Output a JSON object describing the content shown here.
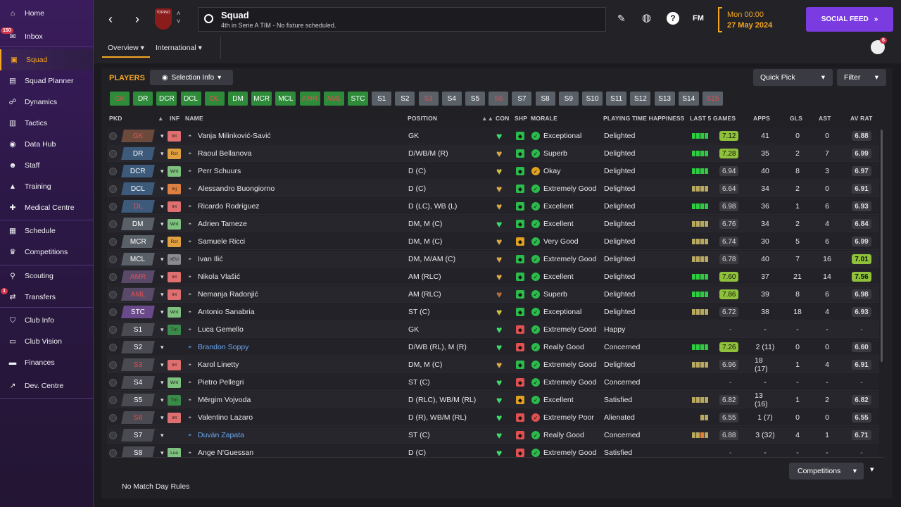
{
  "sidebar": {
    "items": [
      {
        "label": "Home",
        "icon": "home-icon"
      },
      {
        "label": "Inbox",
        "icon": "inbox-icon",
        "badge": "150"
      },
      {
        "label": "Squad",
        "icon": "shirt-icon"
      },
      {
        "label": "Squad Planner",
        "icon": "clipboard-icon"
      },
      {
        "label": "Dynamics",
        "icon": "people-icon"
      },
      {
        "label": "Tactics",
        "icon": "tactics-board-icon"
      },
      {
        "label": "Data Hub",
        "icon": "data-icon"
      },
      {
        "label": "Staff",
        "icon": "staff-icon"
      },
      {
        "label": "Training",
        "icon": "cone-icon"
      },
      {
        "label": "Medical Centre",
        "icon": "medical-kit-icon"
      },
      {
        "label": "Schedule",
        "icon": "calendar-icon"
      },
      {
        "label": "Competitions",
        "icon": "trophy-icon"
      },
      {
        "label": "Scouting",
        "icon": "magnifier-icon"
      },
      {
        "label": "Transfers",
        "icon": "transfer-icon",
        "badge": "1"
      },
      {
        "label": "Club Info",
        "icon": "shield-icon"
      },
      {
        "label": "Club Vision",
        "icon": "briefcase-icon"
      },
      {
        "label": "Finances",
        "icon": "money-icon"
      },
      {
        "label": "Dev. Centre",
        "icon": "dev-centre-icon"
      }
    ]
  },
  "header": {
    "title": "Squad",
    "subtitle": "4th in Serie A TIM - No fixture scheduled.",
    "club_crest": "TORINO",
    "date_time": "Mon 00:00",
    "date": "27 May 2024",
    "social_feed": "SOCIAL FEED",
    "fm_label": "FM",
    "notif_badge": "6"
  },
  "tabs": [
    {
      "label": "Overview"
    },
    {
      "label": "International"
    }
  ],
  "players_section": {
    "heading": "PLAYERS",
    "selection_info": "Selection Info",
    "quick_pick": "Quick Pick",
    "filter": "Filter"
  },
  "position_filters": [
    {
      "label": "GK",
      "style": "greenr"
    },
    {
      "label": "DR",
      "style": "green"
    },
    {
      "label": "DCR",
      "style": "green"
    },
    {
      "label": "DCL",
      "style": "green"
    },
    {
      "label": "DL",
      "style": "greenr"
    },
    {
      "label": "DM",
      "style": "green"
    },
    {
      "label": "MCR",
      "style": "green"
    },
    {
      "label": "MCL",
      "style": "green"
    },
    {
      "label": "AMR",
      "style": "greenr"
    },
    {
      "label": "AML",
      "style": "greenr"
    },
    {
      "label": "STC",
      "style": "green"
    },
    {
      "label": "S1",
      "style": "grey"
    },
    {
      "label": "S2",
      "style": "grey"
    },
    {
      "label": "S3",
      "style": "greyr"
    },
    {
      "label": "S4",
      "style": "grey"
    },
    {
      "label": "S5",
      "style": "grey"
    },
    {
      "label": "S6",
      "style": "greyr"
    },
    {
      "label": "S7",
      "style": "grey"
    },
    {
      "label": "S8",
      "style": "grey"
    },
    {
      "label": "S9",
      "style": "grey"
    },
    {
      "label": "S10",
      "style": "grey"
    },
    {
      "label": "S11",
      "style": "grey"
    },
    {
      "label": "S12",
      "style": "grey"
    },
    {
      "label": "S13",
      "style": "grey"
    },
    {
      "label": "S14",
      "style": "grey"
    },
    {
      "label": "S15",
      "style": "greyr"
    }
  ],
  "columns": {
    "pkd": "PKD",
    "inf": "INF",
    "name": "NAME",
    "position": "POSITION",
    "con": "CON",
    "shp": "SHP",
    "morale": "MORALE",
    "pth": "PLAYING TIME HAPPINESS",
    "last5": "LAST 5 GAMES",
    "apps": "APPS",
    "gls": "GLS",
    "ast": "AST",
    "avrat": "AV RAT"
  },
  "players": [
    {
      "pkd": "GK",
      "pkd_col": "#6b4a3c",
      "pkd_red": true,
      "inf": "Int",
      "inf_col": "#e07070",
      "name": "Vanja Milinković-Savić",
      "link": false,
      "pos": "GK",
      "con": "#3ddc6a",
      "shp": "#2bbb4a",
      "morale_col": "#2bbb4a",
      "morale": "Exceptional",
      "pth": "Delighted",
      "bars": [
        "g",
        "g",
        "g",
        "g"
      ],
      "l5": "7.12",
      "l5_chip": true,
      "apps": "41",
      "gls": "0",
      "ast": "0",
      "avr": "6.88",
      "avr_chip": false
    },
    {
      "pkd": "DR",
      "pkd_col": "#3d5a7a",
      "inf": "Rst",
      "inf_col": "#e0a040",
      "name": "Raoul Bellanova",
      "pos": "D/WB/M (R)",
      "con": "#d9a84a",
      "shp": "#2bbb4a",
      "morale_col": "#2bbb4a",
      "morale": "Superb",
      "pth": "Delighted",
      "bars": [
        "g",
        "g",
        "g",
        "g"
      ],
      "l5": "7.28",
      "l5_chip": true,
      "apps": "35",
      "gls": "2",
      "ast": "7",
      "avr": "6.99"
    },
    {
      "pkd": "DCR",
      "pkd_col": "#3d5a7a",
      "inf": "Wnt",
      "inf_col": "#7ec07e",
      "name": "Perr Schuurs",
      "pos": "D (C)",
      "con": "#c8c040",
      "shp": "#2bbb4a",
      "morale_col": "#e0a020",
      "morale": "Okay",
      "pth": "Delighted",
      "bars": [
        "g",
        "g",
        "g",
        "g"
      ],
      "l5": "6.94",
      "apps": "40",
      "gls": "8",
      "ast": "3",
      "avr": "6.97"
    },
    {
      "pkd": "DCL",
      "pkd_col": "#3d5a7a",
      "inf": "Inj",
      "inf_col": "#e08040",
      "name": "Alessandro Buongiorno",
      "pos": "D (C)",
      "con": "#d9a84a",
      "shp": "#2bbb4a",
      "morale_col": "#2bbb4a",
      "morale": "Extremely Good",
      "pth": "Delighted",
      "bars": [
        "y",
        "y",
        "y",
        "y"
      ],
      "l5": "6.64",
      "apps": "34",
      "gls": "2",
      "ast": "0",
      "avr": "6.91"
    },
    {
      "pkd": "DL",
      "pkd_col": "#3d5a7a",
      "pkd_red": true,
      "inf": "Int",
      "inf_col": "#e07070",
      "name": "Ricardo Rodríguez",
      "pos": "D (LC), WB (L)",
      "con": "#d9a84a",
      "shp": "#2bbb4a",
      "morale_col": "#2bbb4a",
      "morale": "Excellent",
      "pth": "Delighted",
      "bars": [
        "g",
        "g",
        "g",
        "g"
      ],
      "l5": "6.98",
      "apps": "36",
      "gls": "1",
      "ast": "6",
      "avr": "6.93"
    },
    {
      "pkd": "DM",
      "pkd_col": "#5a6068",
      "inf": "Wnt",
      "inf_col": "#7ec07e",
      "name": "Adrien Tameze",
      "pos": "DM, M (C)",
      "con": "#3ddc6a",
      "shp": "#2bbb4a",
      "morale_col": "#2bbb4a",
      "morale": "Excellent",
      "pth": "Delighted",
      "bars": [
        "y",
        "y",
        "y",
        "y"
      ],
      "l5": "6.76",
      "apps": "34",
      "gls": "2",
      "ast": "4",
      "avr": "6.84"
    },
    {
      "pkd": "MCR",
      "pkd_col": "#5a6068",
      "inf": "Rst",
      "inf_col": "#e0a040",
      "name": "Samuele Ricci",
      "pos": "DM, M (C)",
      "con": "#d9a84a",
      "shp": "#e0a020",
      "morale_col": "#2bbb4a",
      "morale": "Very Good",
      "pth": "Delighted",
      "bars": [
        "y",
        "y",
        "y",
        "y"
      ],
      "l5": "6.74",
      "apps": "30",
      "gls": "5",
      "ast": "6",
      "avr": "6.99"
    },
    {
      "pkd": "MCL",
      "pkd_col": "#5a6068",
      "inf": "nEU",
      "inf_col": "#8a8a90",
      "name": "Ivan Ilić",
      "pos": "DM, M/AM (C)",
      "con": "#d9a84a",
      "shp": "#2bbb4a",
      "morale_col": "#2bbb4a",
      "morale": "Extremely Good",
      "pth": "Delighted",
      "bars": [
        "y",
        "y",
        "y",
        "y"
      ],
      "l5": "6.78",
      "apps": "40",
      "gls": "7",
      "ast": "16",
      "avr": "7.01",
      "avr_chip": true
    },
    {
      "pkd": "AMR",
      "pkd_col": "#5a4a6a",
      "pkd_red": true,
      "inf": "Int",
      "inf_col": "#e07070",
      "name": "Nikola Vlašić",
      "pos": "AM (RLC)",
      "con": "#d9a84a",
      "shp": "#2bbb4a",
      "morale_col": "#2bbb4a",
      "morale": "Excellent",
      "pth": "Delighted",
      "bars": [
        "g",
        "g",
        "g",
        "g"
      ],
      "l5": "7.60",
      "l5_chip": true,
      "apps": "37",
      "gls": "21",
      "ast": "14",
      "avr": "7.56",
      "avr_chip": true
    },
    {
      "pkd": "AML",
      "pkd_col": "#5a4a6a",
      "pkd_red": true,
      "inf": "Int",
      "inf_col": "#e07070",
      "name": "Nemanja Radonjić",
      "pos": "AM (RLC)",
      "con": "#b0703a",
      "shp": "#2bbb4a",
      "morale_col": "#2bbb4a",
      "morale": "Superb",
      "pth": "Delighted",
      "bars": [
        "g",
        "g",
        "g",
        "g"
      ],
      "l5": "7.86",
      "l5_chip": true,
      "apps": "39",
      "gls": "8",
      "ast": "6",
      "avr": "6.98"
    },
    {
      "pkd": "STC",
      "pkd_col": "#6a4a8a",
      "inf": "Wnt",
      "inf_col": "#7ec07e",
      "name": "Antonio Sanabria",
      "pos": "ST (C)",
      "con": "#c8c040",
      "shp": "#2bbb4a",
      "morale_col": "#2bbb4a",
      "morale": "Exceptional",
      "pth": "Delighted",
      "bars": [
        "y",
        "y",
        "y",
        "y"
      ],
      "l5": "6.72",
      "apps": "38",
      "gls": "18",
      "ast": "4",
      "avr": "6.93"
    },
    {
      "pkd": "S1",
      "pkd_col": "#4a4a52",
      "inf": "Trn",
      "inf_col": "#3a8a4a",
      "name": "Luca Gemello",
      "pos": "GK",
      "con": "#3ddc6a",
      "shp": "#e05050",
      "morale_col": "#2bbb4a",
      "morale": "Extremely Good",
      "pth": "Happy",
      "bars": [],
      "l5": "-",
      "apps": "-",
      "gls": "-",
      "ast": "-",
      "avr": "-"
    },
    {
      "pkd": "S2",
      "pkd_col": "#4a4a52",
      "inf": "",
      "inf_col": "",
      "name": "Brandon Soppy",
      "link": true,
      "pos": "D/WB (RL), M (R)",
      "con": "#3ddc6a",
      "shp": "#e05050",
      "morale_col": "#2bbb4a",
      "morale": "Really Good",
      "pth": "Concerned",
      "bars": [
        "g",
        "g",
        "g",
        "g"
      ],
      "l5": "7.26",
      "l5_chip": true,
      "apps": "2 (11)",
      "gls": "0",
      "ast": "0",
      "avr": "6.60"
    },
    {
      "pkd": "S3",
      "pkd_col": "#4a4a52",
      "pkd_red": true,
      "inf": "Int",
      "inf_col": "#e07070",
      "name": "Karol Linetty",
      "pos": "DM, M (C)",
      "con": "#d9a84a",
      "shp": "#2bbb4a",
      "morale_col": "#2bbb4a",
      "morale": "Extremely Good",
      "pth": "Delighted",
      "bars": [
        "y",
        "y",
        "y",
        "y"
      ],
      "l5": "6.96",
      "apps": "18 (17)",
      "gls": "1",
      "ast": "4",
      "avr": "6.91"
    },
    {
      "pkd": "S4",
      "pkd_col": "#4a4a52",
      "inf": "Wnt",
      "inf_col": "#7ec07e",
      "name": "Pietro Pellegri",
      "pos": "ST (C)",
      "con": "#3ddc6a",
      "shp": "#e05050",
      "morale_col": "#2bbb4a",
      "morale": "Extremely Good",
      "pth": "Concerned",
      "bars": [],
      "l5": "-",
      "apps": "-",
      "gls": "-",
      "ast": "-",
      "avr": "-"
    },
    {
      "pkd": "S5",
      "pkd_col": "#4a4a52",
      "inf": "Trn",
      "inf_col": "#3a8a4a",
      "name": "Mërgim Vojvoda",
      "pos": "D (RLC), WB/M (RL)",
      "con": "#3ddc6a",
      "shp": "#e0a020",
      "morale_col": "#2bbb4a",
      "morale": "Excellent",
      "pth": "Satisfied",
      "bars": [
        "y",
        "y",
        "y",
        "y"
      ],
      "l5": "6.82",
      "apps": "13 (16)",
      "gls": "1",
      "ast": "2",
      "avr": "6.82"
    },
    {
      "pkd": "S6",
      "pkd_col": "#4a4a52",
      "pkd_red": true,
      "inf": "Int",
      "inf_col": "#e07070",
      "name": "Valentino Lazaro",
      "pos": "D (R), WB/M (RL)",
      "con": "#3ddc6a",
      "shp": "#e05050",
      "morale_col": "#e05050",
      "morale": "Extremely Poor",
      "pth": "Alienated",
      "bars": [
        "y",
        "y"
      ],
      "l5": "6.55",
      "apps": "1 (7)",
      "gls": "0",
      "ast": "0",
      "avr": "6.55"
    },
    {
      "pkd": "S7",
      "pkd_col": "#4a4a52",
      "inf": "",
      "inf_col": "",
      "name": "Duván Zapata",
      "link": true,
      "pos": "ST (C)",
      "con": "#3ddc6a",
      "shp": "#e05050",
      "morale_col": "#2bbb4a",
      "morale": "Really Good",
      "pth": "Concerned",
      "bars": [
        "y",
        "y",
        "o",
        "y"
      ],
      "l5": "6.88",
      "apps": "3 (32)",
      "gls": "4",
      "ast": "1",
      "avr": "6.71"
    },
    {
      "pkd": "S8",
      "pkd_col": "#4a4a52",
      "inf": "Loa",
      "inf_col": "#7ec07e",
      "name": "Ange N'Guessan",
      "pos": "D (C)",
      "con": "#3ddc6a",
      "shp": "#e05050",
      "morale_col": "#2bbb4a",
      "morale": "Extremely Good",
      "pth": "Satisfied",
      "bars": [],
      "l5": "-",
      "apps": "-",
      "gls": "-",
      "ast": "-",
      "avr": "-"
    }
  ],
  "footer": {
    "rules": "No Match Day Rules",
    "competitions": "Competitions"
  }
}
